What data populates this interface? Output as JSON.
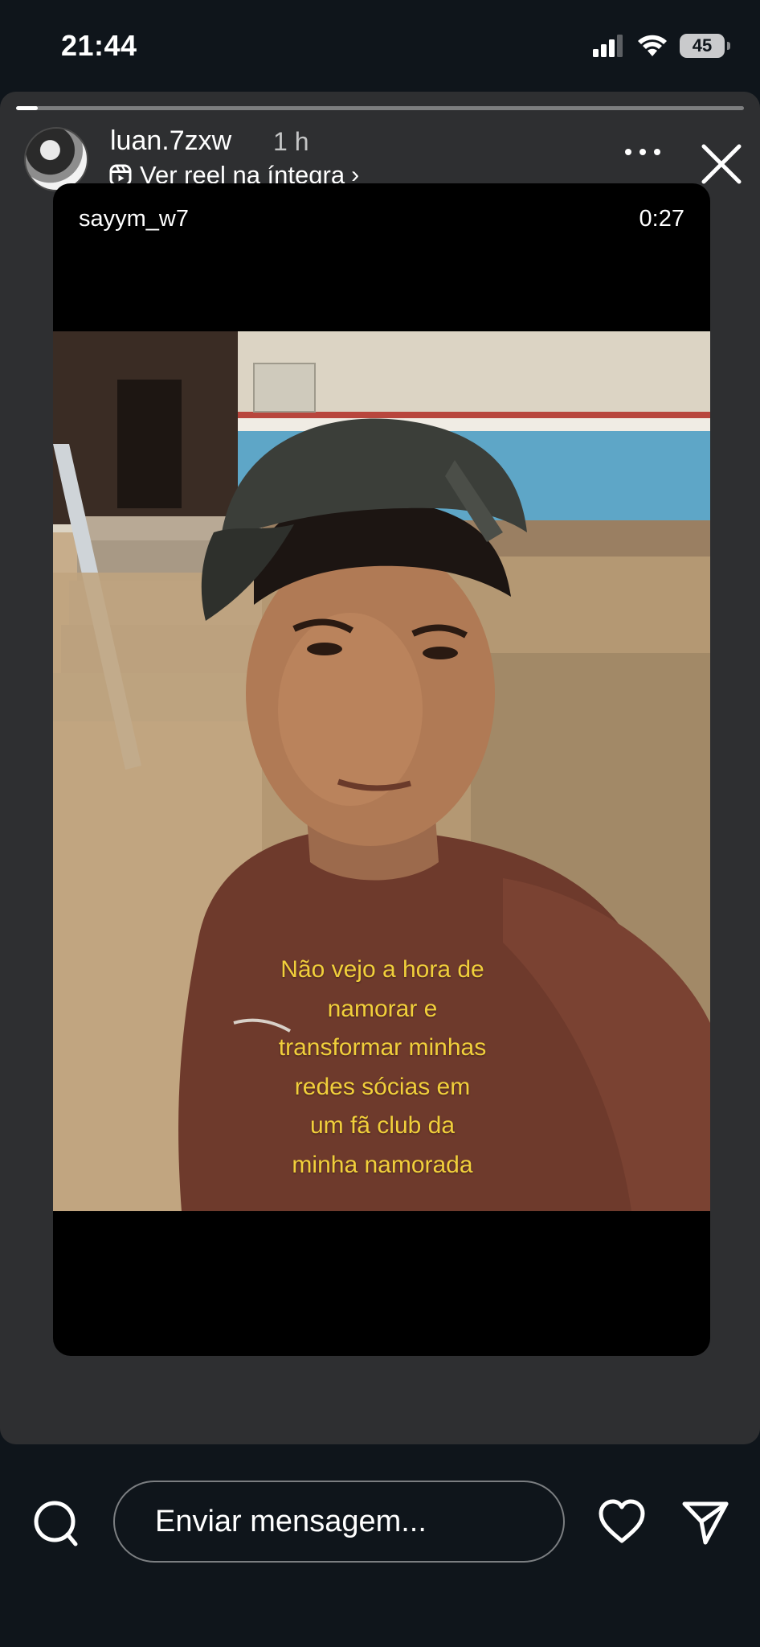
{
  "status_bar": {
    "time": "21:44",
    "battery": "45",
    "icons": [
      "cellular-signal-icon",
      "wifi-icon",
      "battery-icon"
    ]
  },
  "story": {
    "progress": 0.03,
    "username": "luan.7zxw",
    "time_ago": "1 h",
    "reel_link_label": "Ver reel na íntegra",
    "reel_link_chevron": "›",
    "reel": {
      "author": "sayym_w7",
      "duration": "0:27",
      "caption_lines": [
        "Não vejo a hora de",
        "namorar e",
        "transformar minhas",
        "redes sócias em",
        "um fã club da",
        "minha namorada"
      ]
    }
  },
  "bottom_bar": {
    "message_placeholder": "Enviar mensagem..."
  },
  "colors": {
    "background": "#0f151b",
    "story_card": "#2e2f31",
    "caption": "#f1cf3b"
  }
}
